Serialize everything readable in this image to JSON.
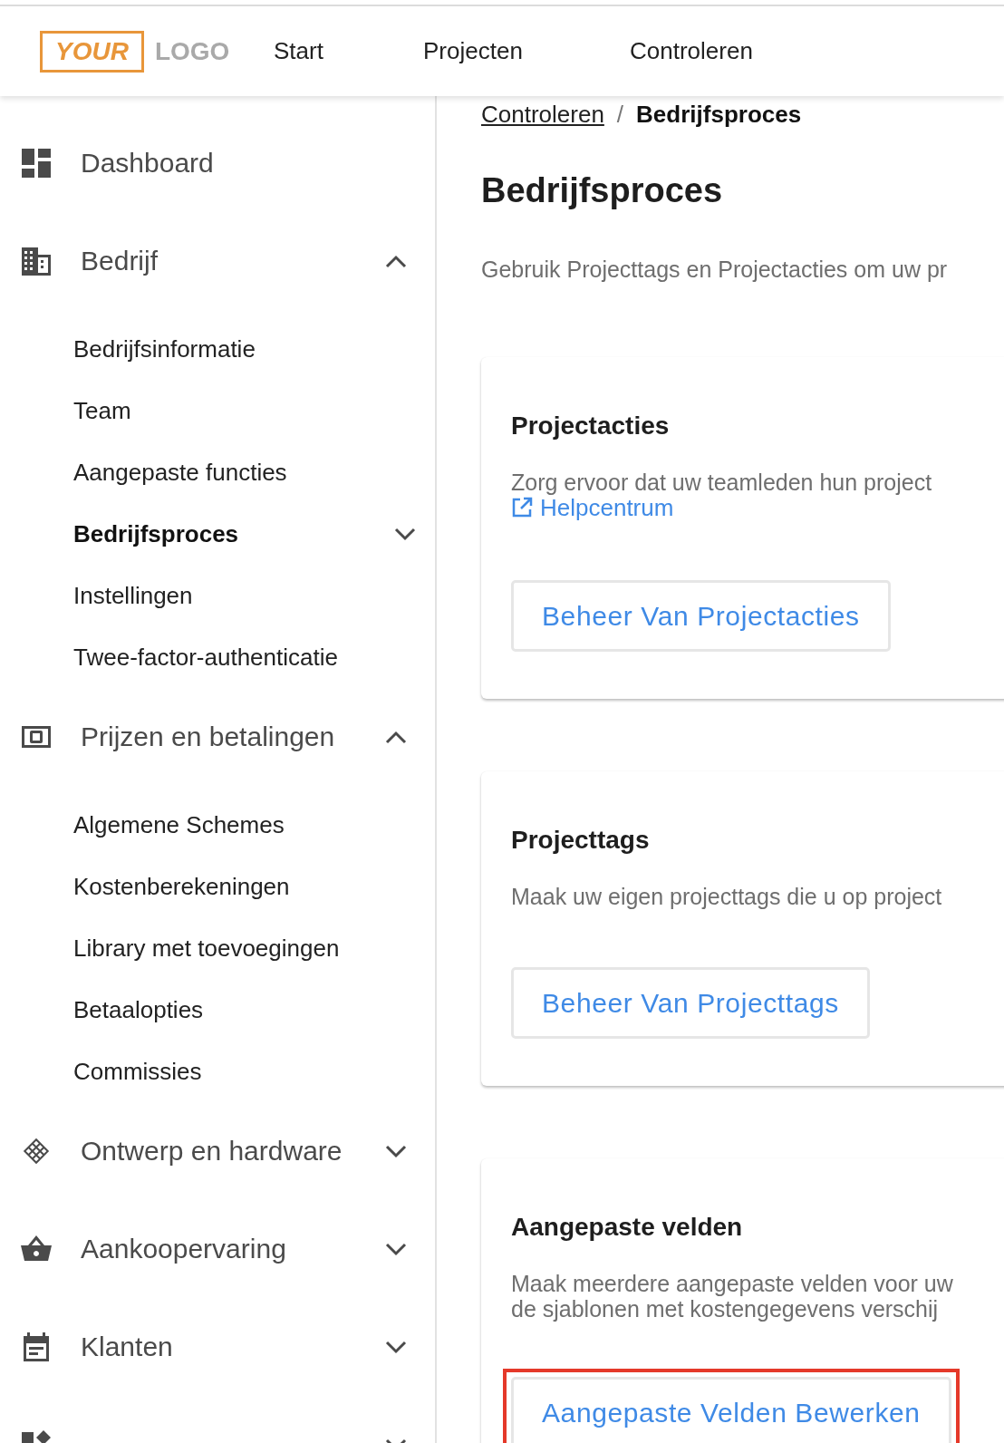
{
  "header": {
    "logo": {
      "word_1": "YOUR",
      "word_2": "LOGO"
    },
    "nav": [
      {
        "label": "Start"
      },
      {
        "label": "Projecten"
      },
      {
        "label": "Controleren"
      }
    ]
  },
  "sidebar": {
    "items": [
      {
        "label": "Dashboard",
        "kind": "link"
      },
      {
        "label": "Bedrijf",
        "kind": "group",
        "expanded": true,
        "children": [
          {
            "label": "Bedrijfsinformatie",
            "kind": "link",
            "selected": false
          },
          {
            "label": "Team",
            "kind": "link",
            "selected": false
          },
          {
            "label": "Aangepaste functies",
            "kind": "link",
            "selected": false
          },
          {
            "label": "Bedrijfsproces",
            "kind": "group",
            "expanded": false,
            "selected": true
          },
          {
            "label": "Instellingen",
            "kind": "link",
            "selected": false
          },
          {
            "label": "Twee-factor-authenticatie",
            "kind": "link",
            "selected": false
          }
        ]
      },
      {
        "label": "Prijzen en betalingen",
        "kind": "group",
        "expanded": true,
        "children": [
          {
            "label": "Algemene Schemes",
            "kind": "link",
            "selected": false
          },
          {
            "label": "Kostenberekeningen",
            "kind": "link",
            "selected": false
          },
          {
            "label": "Library met toevoegingen",
            "kind": "link",
            "selected": false
          },
          {
            "label": "Betaalopties",
            "kind": "link",
            "selected": false
          },
          {
            "label": "Commissies",
            "kind": "link",
            "selected": false
          }
        ]
      },
      {
        "label": "Ontwerp en hardware",
        "kind": "group",
        "expanded": false
      },
      {
        "label": "Aankoopervaring",
        "kind": "group",
        "expanded": false
      },
      {
        "label": "Klanten",
        "kind": "group",
        "expanded": false
      },
      {
        "kind": "group",
        "expanded": false
      }
    ]
  },
  "breadcrumb": {
    "separator": "/",
    "items": [
      {
        "label": "Controleren",
        "kind": "link"
      },
      {
        "label": "Bedrijfsproces",
        "kind": "current"
      }
    ]
  },
  "title": "Bedrijfsproces",
  "description": "Gebruik Projecttags en Projectacties om uw pr",
  "cards": [
    {
      "title": "Projectacties",
      "lines": [
        "Zorg ervoor dat uw teamleden hun project"
      ],
      "link": {
        "label": "Helpcentrum"
      },
      "button": {
        "label": "Beheer Van Projectacties",
        "highlighted": false
      }
    },
    {
      "title": "Projecttags",
      "lines": [
        "Maak uw eigen projecttags die u op project"
      ],
      "button": {
        "label": "Beheer Van Projecttags",
        "highlighted": false
      }
    },
    {
      "title": "Aangepaste velden",
      "lines": [
        "Maak meerdere aangepaste velden voor uw",
        "de sjablonen met kostengegevens verschij"
      ],
      "button": {
        "label": "Aangepaste Velden Bewerken",
        "highlighted": true
      }
    }
  ]
}
